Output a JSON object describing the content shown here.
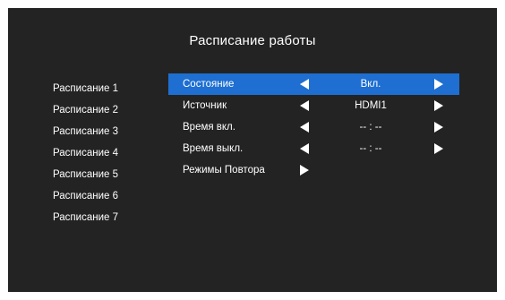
{
  "title": "Расписание работы",
  "schedules": [
    {
      "label": "Расписание 1"
    },
    {
      "label": "Расписание 2"
    },
    {
      "label": "Расписание 3"
    },
    {
      "label": "Расписание 4"
    },
    {
      "label": "Расписание 5"
    },
    {
      "label": "Расписание 6"
    },
    {
      "label": "Расписание 7"
    }
  ],
  "settings": {
    "state": {
      "label": "Состояние",
      "value": "Вкл."
    },
    "source": {
      "label": "Источник",
      "value": "HDMI1"
    },
    "on_time": {
      "label": "Время вкл.",
      "value": "-- : --"
    },
    "off_time": {
      "label": "Время выкл.",
      "value": "-- : --"
    },
    "repeat": {
      "label": "Режимы Повтора"
    }
  },
  "colors": {
    "background": "#232323",
    "highlight": "#1e6fd1",
    "text": "#ffffff"
  }
}
